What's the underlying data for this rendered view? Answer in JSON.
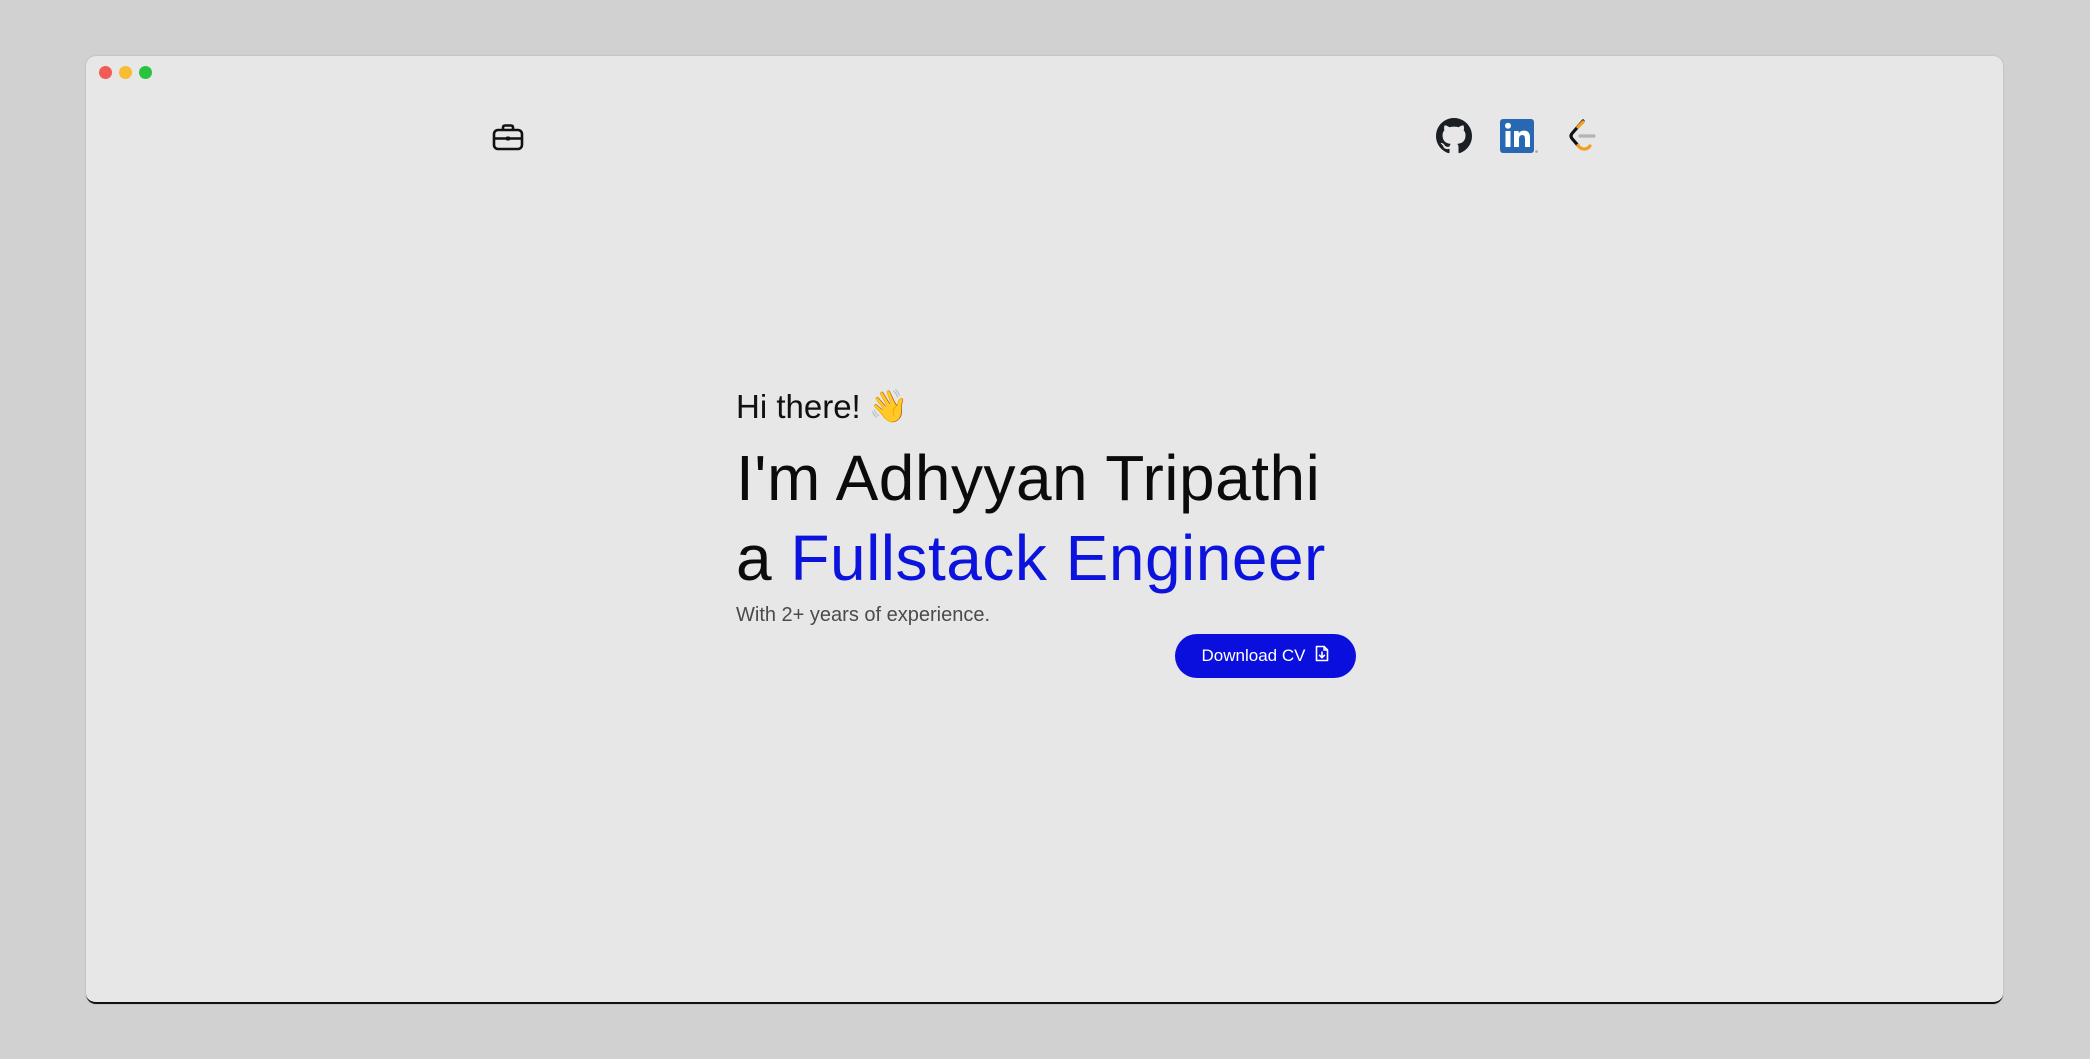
{
  "window": {
    "controls": [
      "close",
      "minimize",
      "maximize"
    ]
  },
  "nav": {
    "left_icon": "briefcase-icon",
    "social_icons": [
      "github-icon",
      "linkedin-icon",
      "leetcode-icon"
    ]
  },
  "hero": {
    "greeting": "Hi there!",
    "greeting_emoji": "👋",
    "name_line": "I'm Adhyyan Tripathi",
    "role_prefix": "a",
    "role": "Fullstack Engineer",
    "subtitle": "With 2+ years of experience.",
    "cta_label": "Download CV",
    "cta_icon": "file-download-icon"
  },
  "colors": {
    "page_bg": "#d1d1d1",
    "window_bg": "#e7e7e7",
    "accent": "#0b13dc",
    "button_bg": "#0b0fdd",
    "text": "#0b0b0b"
  }
}
